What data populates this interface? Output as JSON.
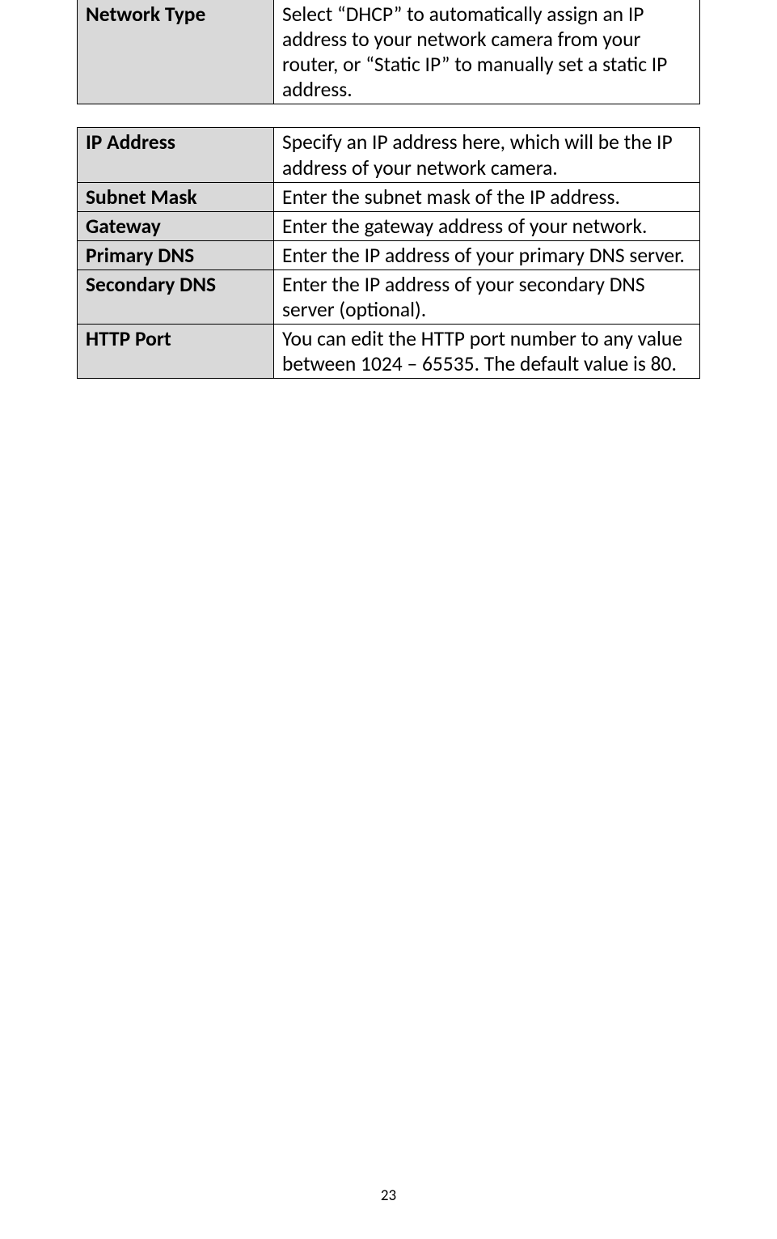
{
  "table1": {
    "rows": [
      {
        "label": "Network Type",
        "desc": "Select “DHCP” to automatically assign an IP address to your network camera from your router, or “Static IP” to manually set a static IP address."
      }
    ]
  },
  "table2": {
    "rows": [
      {
        "label": "IP Address",
        "desc": "Specify an IP address here, which will be the IP address of your network camera."
      },
      {
        "label": "Subnet Mask",
        "desc": "Enter the subnet mask of the IP address."
      },
      {
        "label": "Gateway",
        "desc": "Enter the gateway address of your network."
      },
      {
        "label": "Primary DNS",
        "desc": "Enter the IP address of your primary DNS server."
      },
      {
        "label": "Secondary DNS",
        "desc": "Enter the IP address of your secondary DNS server (optional)."
      },
      {
        "label": "HTTP Port",
        "desc": "You can edit the HTTP port number to any value between 1024 – 65535. The default value is 80."
      }
    ]
  },
  "pageNumber": "23"
}
